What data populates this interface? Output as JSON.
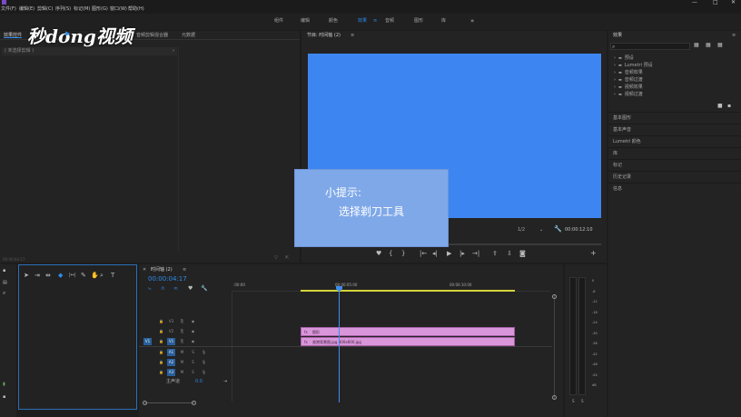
{
  "menubar": {
    "items": [
      "文件(F)",
      "编辑(E)",
      "剪辑(C)",
      "序列(S)",
      "标记(M)",
      "图形(G)",
      "窗口(W)",
      "帮助(H)"
    ],
    "window_controls": [
      "—",
      "□",
      "✕"
    ]
  },
  "workspaces": {
    "items": [
      "组件",
      "编辑",
      "颜色",
      "效果",
      "音频",
      "图形",
      "库"
    ],
    "active_index": 3,
    "active_marker": "≡",
    "overflow": "»"
  },
  "watermark": {
    "text": "秒dong视频",
    "play_glyph": "▶"
  },
  "left_panel": {
    "tabs": [
      "效果控件",
      "音频剪辑混合器",
      "元数据"
    ],
    "placeholder": "( 未选择剪辑 )",
    "arrow": "›",
    "timecode": "00:00:04:17"
  },
  "program_monitor": {
    "tab_label": "节目: 时间轴 (2)",
    "tab_menu": "≡",
    "screen_color": "#3d86f2",
    "zoom": "1/2",
    "timecode": "00:00:12:10"
  },
  "tip_overlay": {
    "title": "小提示:",
    "body": "选择剃刀工具",
    "bg": "#7fa8e8"
  },
  "effects_panel": {
    "title": "效果",
    "menu": "≡",
    "search_icon": "⌕",
    "tree": [
      "预设",
      "Lumetri 预设",
      "音频效果",
      "音频过渡",
      "视频效果",
      "视频过渡"
    ],
    "sections": [
      "基本图形",
      "基本声音",
      "Lumetri 颜色",
      "库",
      "标记",
      "历史记录",
      "信息"
    ]
  },
  "timeline": {
    "tab_close": "✕",
    "tab_label": "时间轴 (2)",
    "tab_menu": "≡",
    "timecode": "00:00:04:17",
    "ruler_labels": [
      ":00:00",
      "00:00:05:00",
      "00:00:10:00"
    ],
    "video_tracks": [
      "V3",
      "V2",
      "V1"
    ],
    "audio_tracks": [
      "A1",
      "A2",
      "A3"
    ],
    "master_label": "主声道",
    "master_value": "0.0",
    "clip_fx": "fx",
    "clips": [
      {
        "label": "图形",
        "track": "V2"
      },
      {
        "label": "香港背景图.jpg 800x600.jpg",
        "track": "V1"
      }
    ],
    "clip_color": "#d996d9",
    "playhead_color": "#3d8ef0",
    "work_area_color": "#d4d43a"
  },
  "audio_meter": {
    "scale": [
      "0",
      "-6",
      "-12",
      "-18",
      "-24",
      "-30",
      "-36",
      "-42",
      "-48",
      "-54",
      "dB"
    ],
    "solo": [
      "S",
      "S"
    ]
  },
  "tools": {
    "items": [
      "selection-tool-icon",
      "track-select-tool-icon",
      "ripple-edit-tool-icon",
      "razor-tool-icon",
      "slip-tool-icon",
      "pen-tool-icon",
      "hand-tool-icon",
      "zoom-tool-icon",
      "type-tool-icon"
    ],
    "active_index": 3
  },
  "colors": {
    "accent": "#2d8ceb",
    "background": "#1d1d1d",
    "panel": "#232323"
  }
}
